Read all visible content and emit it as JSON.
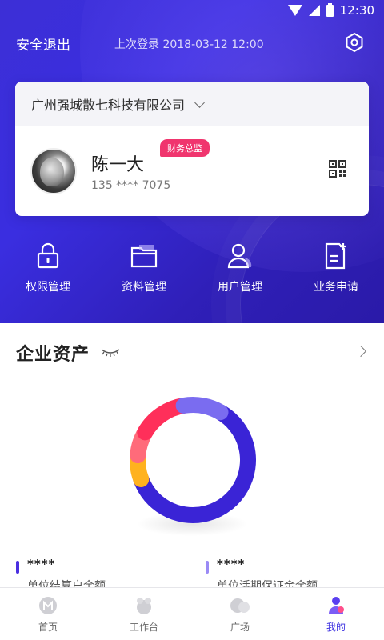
{
  "status_bar": {
    "time": "12:30"
  },
  "header": {
    "logout_label": "安全退出",
    "last_login": "上次登录  2018-03-12 12:00"
  },
  "company_card": {
    "company_name": "广州强城散七科技有限公司",
    "user_name": "陈一大",
    "role_badge": "财务总监",
    "phone": "135 **** 7075"
  },
  "actions": [
    {
      "label": "权限管理",
      "icon": "lock-icon"
    },
    {
      "label": "资料管理",
      "icon": "folder-icon"
    },
    {
      "label": "用户管理",
      "icon": "user-icon"
    },
    {
      "label": "业务申请",
      "icon": "document-add-icon"
    }
  ],
  "assets": {
    "title": "企业资产",
    "segments": [
      {
        "color": "#3a24d6",
        "value": 0.61
      },
      {
        "color": "#ffb21f",
        "value": 0.07
      },
      {
        "color": "#ff6b7a",
        "value": 0.07
      },
      {
        "color": "#ff2f5a",
        "value": 0.14
      },
      {
        "color": "#7a6cf0",
        "value": 0.11
      }
    ],
    "legend": [
      {
        "value": "****",
        "label": "单位结算户余额",
        "color": "#4a2fe0"
      },
      {
        "value": "****",
        "label": "单位活期保证金余额",
        "color": "#9a8af5"
      }
    ]
  },
  "tabbar": [
    {
      "label": "首页",
      "active": false
    },
    {
      "label": "工作台",
      "active": false
    },
    {
      "label": "广场",
      "active": false
    },
    {
      "label": "我的",
      "active": true
    }
  ],
  "colors": {
    "primary": "#3a2ee0",
    "badge": "#f0356e"
  }
}
